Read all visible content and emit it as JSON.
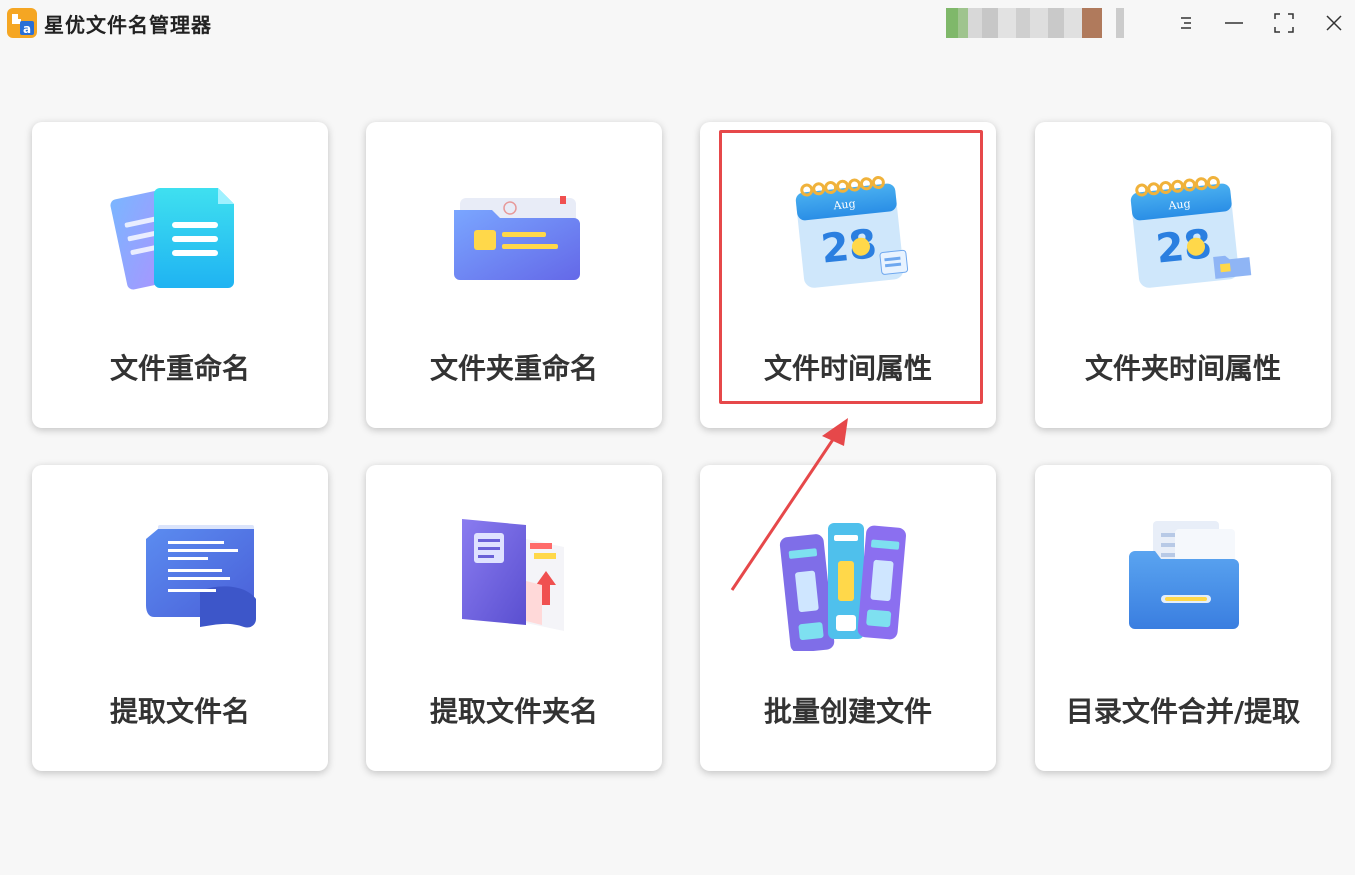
{
  "app": {
    "title": "星优文件名管理器",
    "logo_icon": "app-logo-icon",
    "accent": "#f5a623"
  },
  "window_controls": {
    "menu_icon": "menu-icon",
    "minimize_icon": "minimize-icon",
    "maximize_icon": "maximize-icon",
    "close_icon": "close-icon"
  },
  "cards": [
    {
      "label": "文件重命名",
      "icon": "file-rename-icon"
    },
    {
      "label": "文件夹重命名",
      "icon": "folder-rename-icon"
    },
    {
      "label": "文件时间属性",
      "icon": "calendar-icon",
      "highlighted": true
    },
    {
      "label": "文件夹时间属性",
      "icon": "calendar-folder-icon"
    },
    {
      "label": "提取文件名",
      "icon": "scroll-document-icon"
    },
    {
      "label": "提取文件夹名",
      "icon": "folder-upload-icon"
    },
    {
      "label": "批量创建文件",
      "icon": "binders-icon"
    },
    {
      "label": "目录文件合并/提取",
      "icon": "file-drawer-icon"
    }
  ],
  "annotation": {
    "highlight_color": "#e6484a",
    "highlight_target": "文件时间属性"
  }
}
